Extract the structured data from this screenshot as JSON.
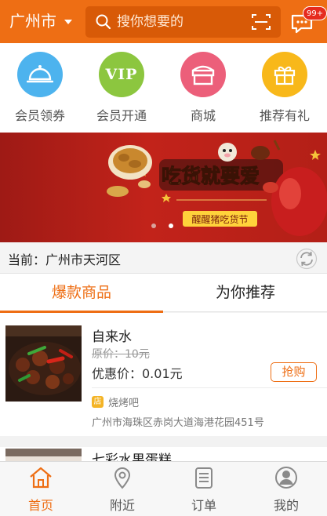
{
  "header": {
    "city": "广州市",
    "search_placeholder": "搜你想要的",
    "message_badge": "99+"
  },
  "quick_entries": [
    {
      "label": "会员领券",
      "icon": "cloche-icon",
      "color": "#4db3ee"
    },
    {
      "label": "会员开通",
      "icon": "vip-icon",
      "color": "#8cc63f",
      "icon_text": "VIP"
    },
    {
      "label": "商城",
      "icon": "store-icon",
      "color": "#ec5f7a"
    },
    {
      "label": "推荐有礼",
      "icon": "gift-icon",
      "color": "#f8b81a"
    }
  ],
  "banner": {
    "headline": "吃货就要爱",
    "tagline": "醒醒猪吃货节",
    "dots": 2,
    "active_dot": 1
  },
  "location": {
    "text": "当前：广州市天河区"
  },
  "tabs": [
    {
      "label": "爆款商品",
      "active": true
    },
    {
      "label": "为你推荐",
      "active": false
    }
  ],
  "products": [
    {
      "name": "自来水",
      "original_price": "原价：10元",
      "discount_price": "优惠价：0.01元",
      "buy_label": "抢购",
      "shop_icon_text": "店",
      "shop": "烧烤吧",
      "address": "广州市海珠区赤岗大道海港花园451号"
    },
    {
      "name": "七彩水果蛋糕"
    }
  ],
  "bottom_nav": [
    {
      "label": "首页",
      "icon": "home-icon",
      "active": true
    },
    {
      "label": "附近",
      "icon": "location-pin-icon",
      "active": false
    },
    {
      "label": "订单",
      "icon": "order-list-icon",
      "active": false
    },
    {
      "label": "我的",
      "icon": "profile-icon",
      "active": false
    }
  ],
  "colors": {
    "accent": "#ee6e14",
    "search_bg": "#d85a07",
    "badge": "#e62b1e"
  }
}
